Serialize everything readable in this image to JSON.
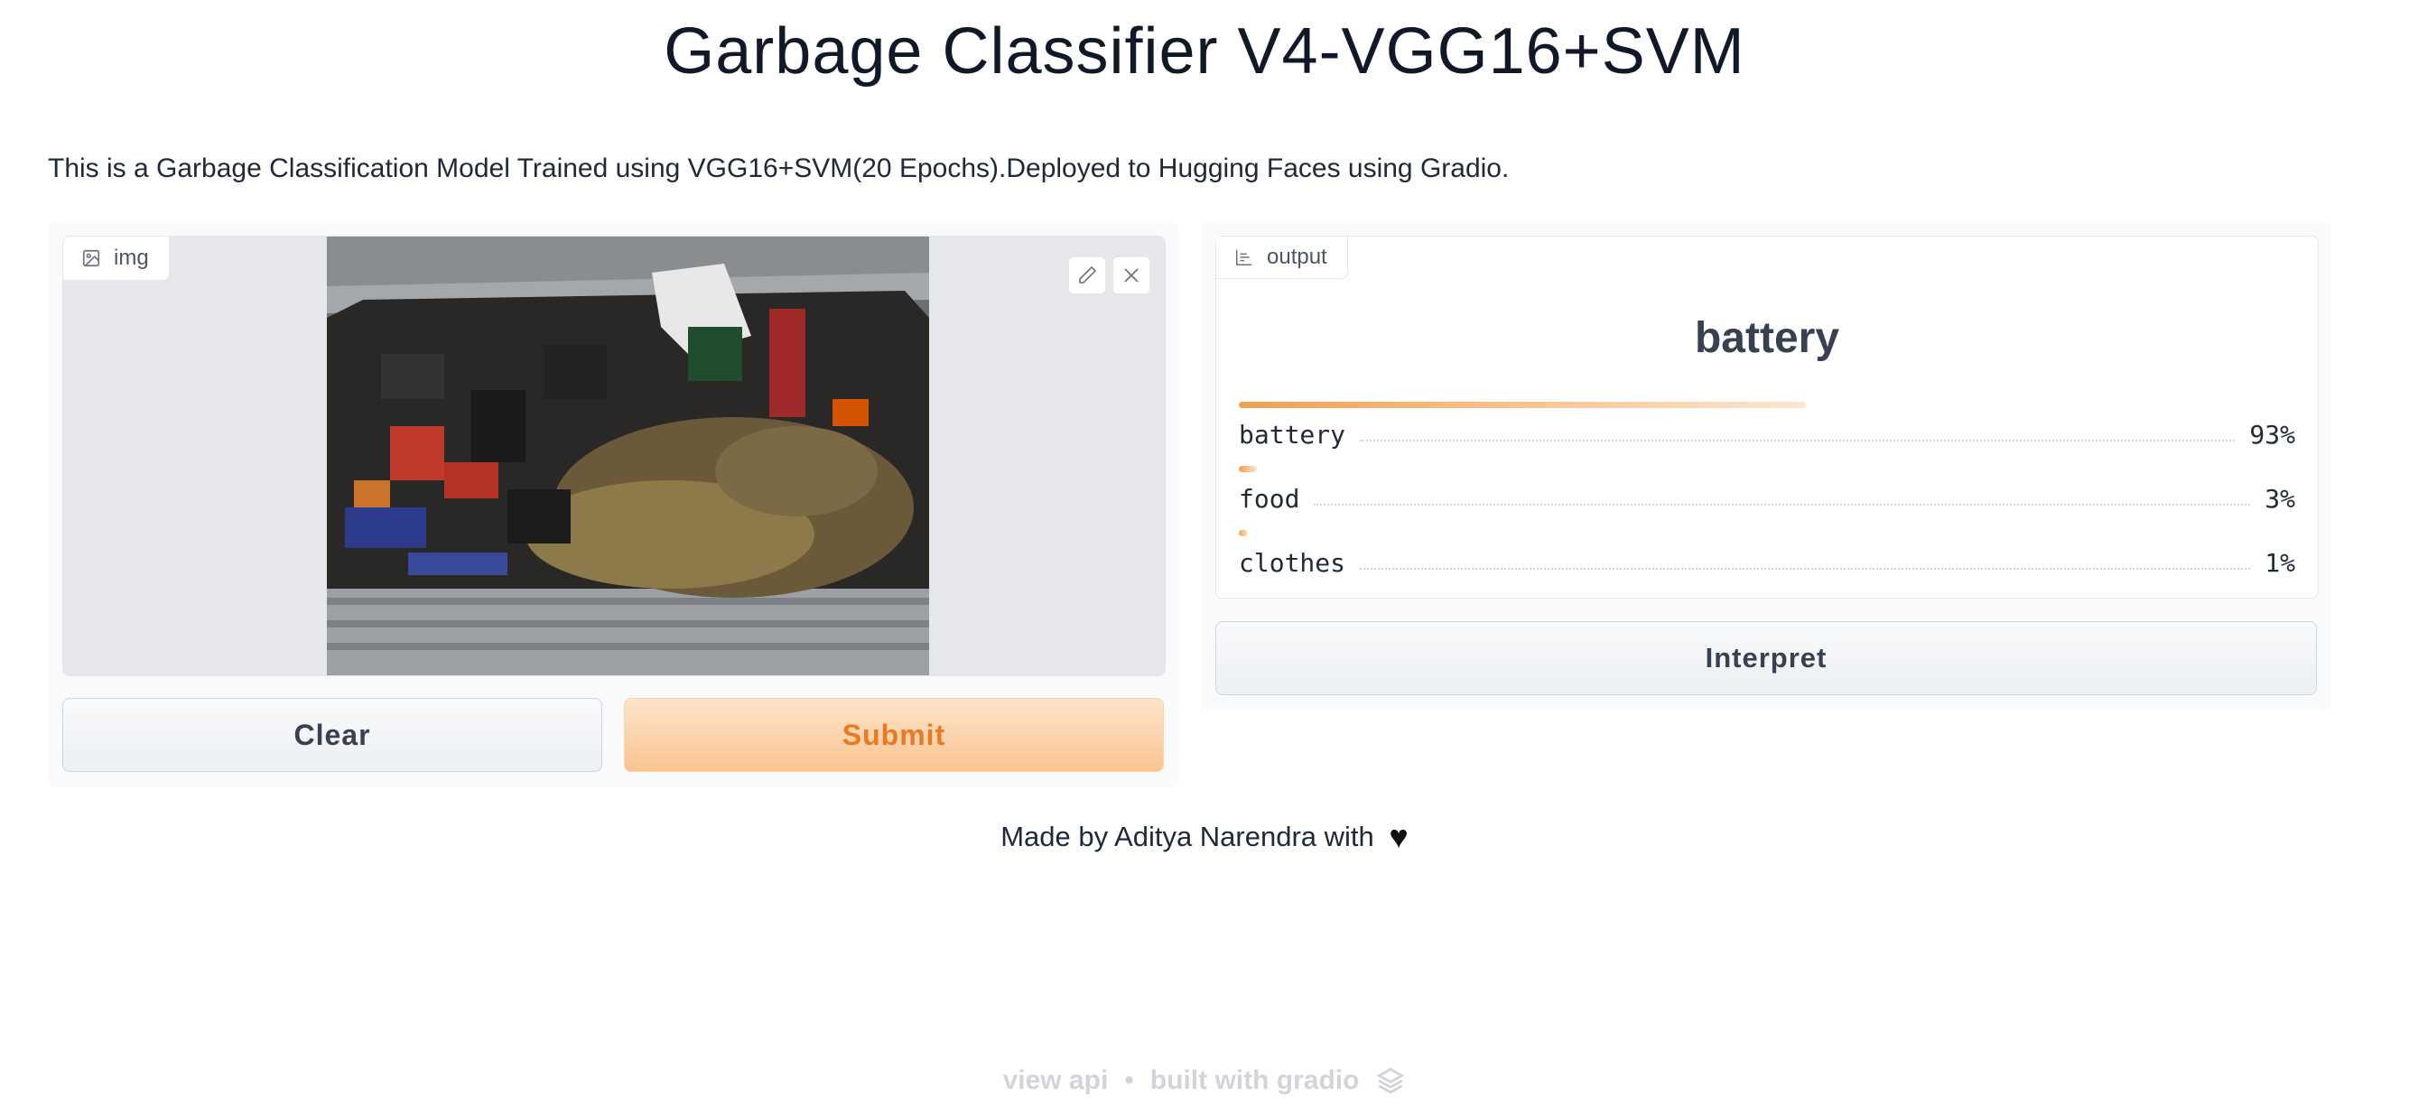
{
  "title": "Garbage Classifier V4-VGG16+SVM",
  "description": "This is a Garbage Classification Model Trained using VGG16+SVM(20 Epochs).Deployed to Hugging Faces using Gradio.",
  "input": {
    "label": "img",
    "label_icon": "image-icon",
    "edit_icon": "pencil-icon",
    "close_icon": "close-icon"
  },
  "buttons": {
    "clear": "Clear",
    "submit": "Submit",
    "interpret": "Interpret"
  },
  "output": {
    "label": "output",
    "label_icon": "chart-icon",
    "top_label": "battery",
    "confidences": [
      {
        "label": "battery",
        "value": 0.93,
        "display": "93%"
      },
      {
        "label": "food",
        "value": 0.03,
        "display": "3%"
      },
      {
        "label": "clothes",
        "value": 0.01,
        "display": "1%"
      }
    ]
  },
  "footer": {
    "made_by": "Made by Aditya Narendra with",
    "heart_icon": "heart-icon",
    "view_api": "view api",
    "separator": "•",
    "built_with": "built with gradio",
    "gradio_icon": "gradio-logo-icon"
  },
  "colors": {
    "accent": "#ea7a22",
    "submit_bg": "#fbd3ab",
    "bar_start": "#f0a050"
  }
}
